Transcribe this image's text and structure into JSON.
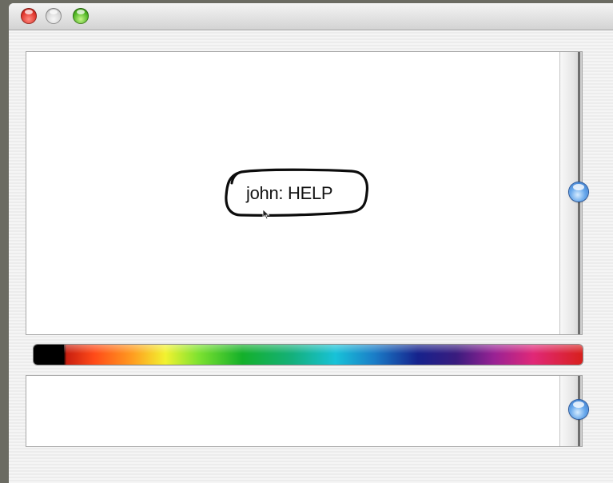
{
  "window": {
    "title_lights": [
      "close",
      "minimize",
      "zoom"
    ]
  },
  "drawing_canvas": {
    "bubble_text": "john: HELP"
  },
  "palette": {
    "selected_color": "#000000",
    "spectrum": [
      "#000000",
      "#c81f10",
      "#ff9c20",
      "#f2f230",
      "#14b02a",
      "#18c2d8",
      "#16228c",
      "#9a2294",
      "#e02878",
      "#d8201c"
    ]
  },
  "colors": {
    "desktop": "#6b6b62",
    "scroll_thumb": "#4a8ee0",
    "close_light": "#e0362c",
    "zoom_light": "#4fb523"
  },
  "icons": {
    "close": "close-light-icon",
    "minimize": "minimize-light-icon",
    "zoom": "zoom-light-icon",
    "pointer": "arrow-cursor-icon"
  }
}
